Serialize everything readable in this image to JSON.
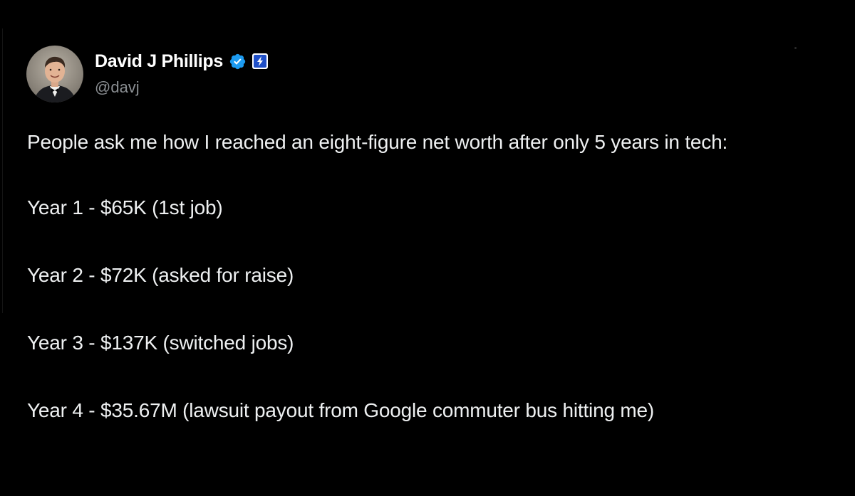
{
  "author": {
    "display_name": "David J Phillips",
    "handle": "@davj",
    "avatar_icon": "profile-photo",
    "verified_icon": "verified-badge-icon",
    "subscription_icon": "lightning-badge-icon",
    "verified_color": "#1d9bf0"
  },
  "tweet": {
    "intro": "People ask me how I reached an eight-figure net worth after only 5 years in tech:",
    "lines": [
      "Year 1 - $65K (1st job)",
      "Year 2 - $72K (asked for raise)",
      "Year 3 - $137K (switched jobs)",
      "Year 4 - $35.67M (lawsuit payout from Google commuter bus hitting me)"
    ]
  },
  "colors": {
    "background": "#000000",
    "text_primary": "#eef0f1",
    "text_secondary": "#8b8f93"
  }
}
